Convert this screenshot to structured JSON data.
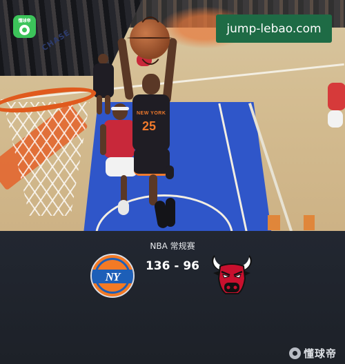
{
  "watermark": {
    "app_badge_text": "懂球帝",
    "url": "jump-lebao.com"
  },
  "photo": {
    "court_text": "CHASE",
    "jersey_team": "NEW YORK",
    "jersey_number": "25"
  },
  "match": {
    "league": "NBA 常规赛",
    "score": "136 - 96",
    "home_team_logo": "knicks-logo",
    "away_team_logo": "bulls-logo",
    "home_logo_text": "NY"
  },
  "footer": {
    "brand": "懂球帝"
  },
  "colors": {
    "panel_bg": "#1d2128",
    "knicks_orange": "#f37a25",
    "knicks_blue": "#1d5fb8",
    "bulls_red": "#c8102e",
    "watermark_green": "#1e6b45"
  }
}
